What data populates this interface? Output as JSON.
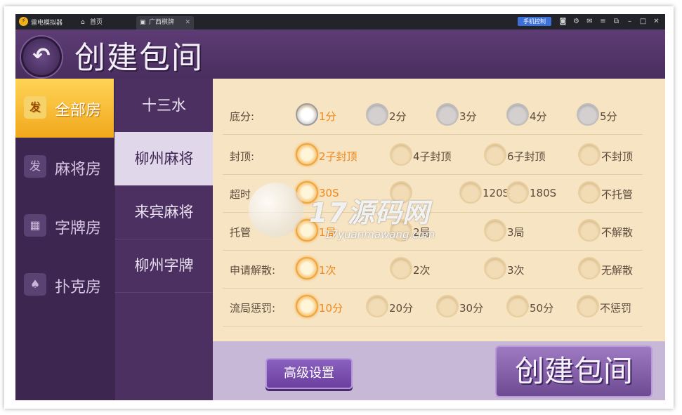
{
  "titlebar": {
    "app_name": "雷电模拟器",
    "tabs": [
      {
        "label": "首页",
        "icon": "home-icon"
      },
      {
        "label": "广西棋牌",
        "icon": "game-icon"
      }
    ],
    "phone_control": "手机控制",
    "icons": [
      "camera-icon",
      "settings-icon",
      "mail-icon",
      "menu-icon",
      "restore-icon",
      "minimize-icon",
      "maximize-icon",
      "close-icon"
    ]
  },
  "header": {
    "title": "创建包间",
    "back_glyph": "↶"
  },
  "room_types": [
    {
      "label": "全部房",
      "icon": "发",
      "active": true
    },
    {
      "label": "麻将房",
      "icon": "发",
      "active": false
    },
    {
      "label": "字牌房",
      "icon": "▦",
      "active": false
    },
    {
      "label": "扑克房",
      "icon": "♠",
      "active": false
    }
  ],
  "games": [
    {
      "label": "十三水",
      "active": false
    },
    {
      "label": "柳州麻将",
      "active": true
    },
    {
      "label": "来宾麻将",
      "active": false
    },
    {
      "label": "柳州字牌",
      "active": false
    }
  ],
  "settings": [
    {
      "label": "底分:",
      "style": "grey",
      "options": [
        "1分",
        "2分",
        "3分",
        "4分",
        "5分"
      ],
      "selected": 0
    },
    {
      "label": "封顶:",
      "style": "gold",
      "options": [
        "2子封顶",
        "4子封顶",
        "6子封顶",
        "不封顶"
      ],
      "selected": 0
    },
    {
      "label": "超时",
      "style": "gold",
      "options": [
        "30S",
        "",
        "120S",
        "180S",
        "不托管"
      ],
      "selected": 0
    },
    {
      "label": "托管",
      "style": "gold",
      "options": [
        "1局",
        "2局",
        "3局",
        "不解散"
      ],
      "selected": 0
    },
    {
      "label": "申请解散:",
      "style": "gold",
      "options": [
        "1次",
        "2次",
        "3次",
        "无解散"
      ],
      "selected": 0
    },
    {
      "label": "流局惩罚:",
      "style": "gold",
      "options": [
        "10分",
        "20分",
        "30分",
        "50分",
        "不惩罚"
      ],
      "selected": 0
    }
  ],
  "buttons": {
    "advanced": "高级设置",
    "create": "创建包间"
  },
  "watermark": {
    "main": "17源码网",
    "sub": "17yuanmawang.com"
  }
}
